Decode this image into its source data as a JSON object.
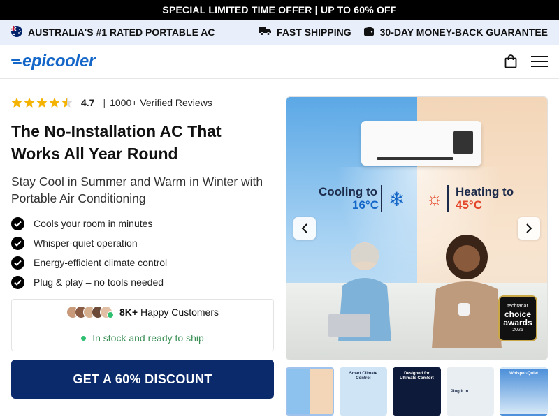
{
  "promo": {
    "text": "SPECIAL LIMITED TIME OFFER | UP TO 60% OFF"
  },
  "usp": {
    "rated": "AUSTRALIA'S #1 RATED PORTABLE AC",
    "shipping": "FAST SHIPPING",
    "guarantee": "30-DAY MONEY-BACK GUARANTEE"
  },
  "header": {
    "logo": "epicooler",
    "icons": [
      "cart-icon",
      "menu-icon"
    ]
  },
  "rating": {
    "value": "4.7",
    "stars": 4.5,
    "separator": "|",
    "reviews": "1000+ Verified Reviews"
  },
  "headline": "The No-Installation AC That Works All Year Round",
  "subhead": "Stay Cool in Summer and Warm in Winter with Portable Air Conditioning",
  "benefits": [
    "Cools your room in minutes",
    "Whisper-quiet operation",
    "Energy-efficient climate control",
    "Plug & play – no tools needed"
  ],
  "social": {
    "count": "8K+",
    "label": "Happy Customers",
    "stock": "In stock and ready to ship"
  },
  "cta": {
    "label": "GET A 60% DISCOUNT"
  },
  "gallery": {
    "cool_label": "Cooling to",
    "cool_temp": "16°C",
    "heat_label": "Heating to",
    "heat_temp": "45°C",
    "badge_brand": "techradar",
    "badge_title": "choice awards",
    "badge_year": "2025",
    "thumbs": [
      {
        "label": "",
        "bg": "#8dc2ee"
      },
      {
        "label": "Smart Climate Control",
        "bg": "#cfe4f5"
      },
      {
        "label": "Designed for Ultimate Comfort",
        "bg": "#0d1a3a"
      },
      {
        "label": "Plug it in",
        "bg": "#e9eef2"
      },
      {
        "label": "Whisper-Quiet",
        "bg": "#4c8fd9"
      }
    ]
  },
  "colors": {
    "accent": "#1467c8",
    "cta": "#0b2a6b",
    "stock": "#3a8f55",
    "star": "#f5b301"
  }
}
